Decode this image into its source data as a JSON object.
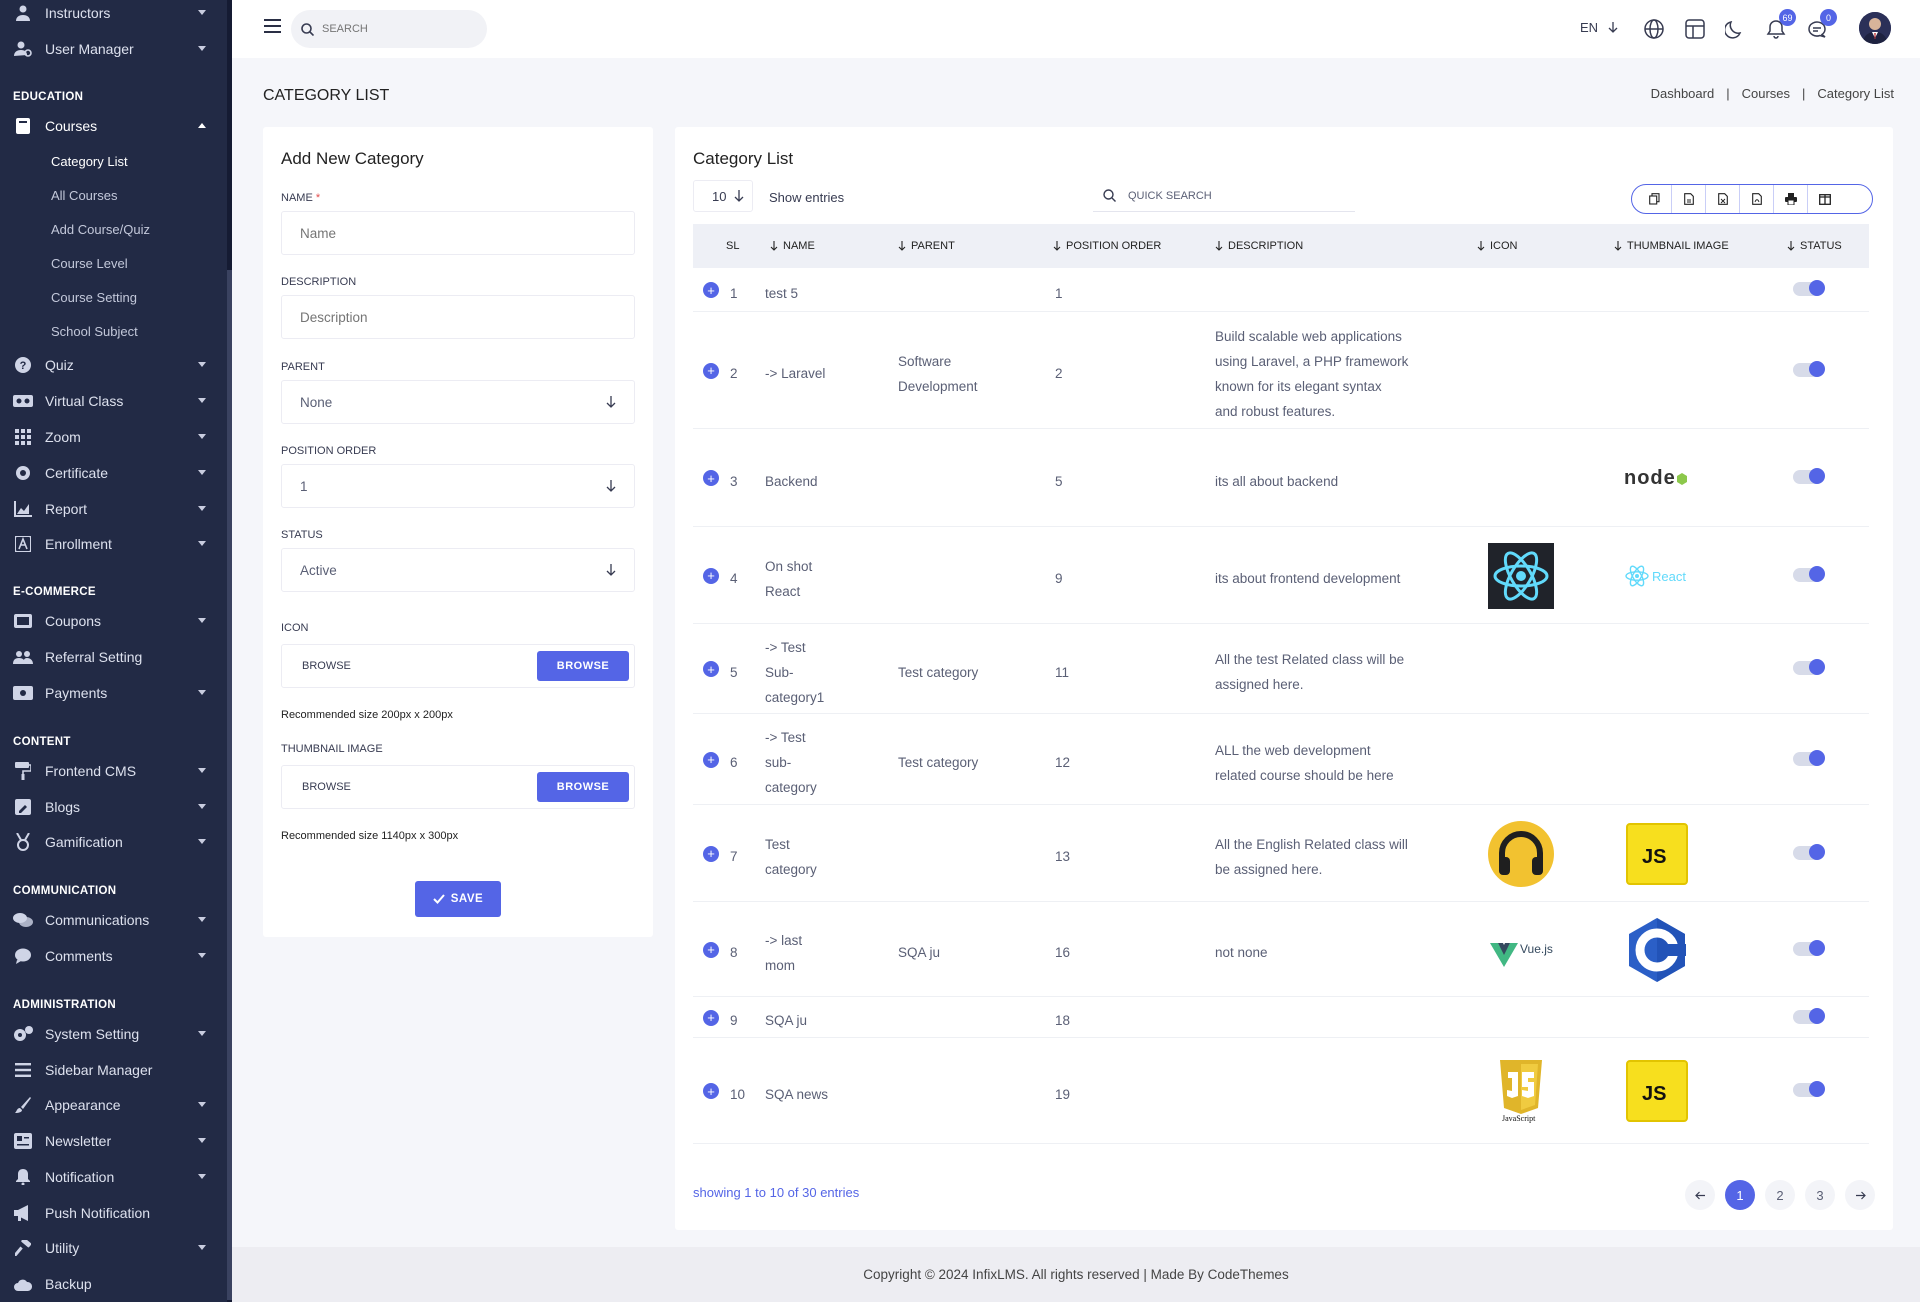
{
  "sidebar": {
    "top_items": [
      {
        "label": "Instructors",
        "icon": "instructor-icon"
      },
      {
        "label": "User Manager",
        "icon": "user-manager-icon"
      }
    ],
    "education_title": "EDUCATION",
    "courses": {
      "label": "Courses",
      "subs": [
        "Category List",
        "All Courses",
        "Add Course/Quiz",
        "Course Level",
        "Course Setting",
        "School Subject"
      ]
    },
    "education_items": [
      {
        "label": "Quiz",
        "icon": "quiz-icon"
      },
      {
        "label": "Virtual Class",
        "icon": "virtual-class-icon"
      },
      {
        "label": "Zoom",
        "icon": "zoom-icon"
      },
      {
        "label": "Certificate",
        "icon": "certificate-icon"
      },
      {
        "label": "Report",
        "icon": "report-icon"
      },
      {
        "label": "Enrollment",
        "icon": "enrollment-icon"
      }
    ],
    "ecommerce_title": "E-COMMERCE",
    "ecommerce_items": [
      {
        "label": "Coupons",
        "icon": "coupon-icon"
      },
      {
        "label": "Referral Setting",
        "icon": "referral-icon"
      },
      {
        "label": "Payments",
        "icon": "payment-icon"
      }
    ],
    "content_title": "CONTENT",
    "content_items": [
      {
        "label": "Frontend CMS",
        "icon": "paint-roller-icon"
      },
      {
        "label": "Blogs",
        "icon": "blog-icon"
      },
      {
        "label": "Gamification",
        "icon": "medal-icon"
      }
    ],
    "communication_title": "COMMUNICATION",
    "communication_items": [
      {
        "label": "Communications",
        "icon": "chat-icon"
      },
      {
        "label": "Comments",
        "icon": "comment-icon"
      }
    ],
    "administration_title": "ADMINISTRATION",
    "administration_items": [
      {
        "label": "System Setting",
        "icon": "gears-icon"
      },
      {
        "label": "Sidebar Manager",
        "icon": "bars-icon"
      },
      {
        "label": "Appearance",
        "icon": "brush-icon"
      },
      {
        "label": "Newsletter",
        "icon": "newsletter-icon"
      },
      {
        "label": "Notification",
        "icon": "bell-icon"
      },
      {
        "label": "Push Notification",
        "icon": "megaphone-icon"
      },
      {
        "label": "Utility",
        "icon": "hammer-icon"
      },
      {
        "label": "Backup",
        "icon": "cloud-icon"
      }
    ]
  },
  "header": {
    "search_placeholder": "SEARCH",
    "language": "EN",
    "notification_count": "69",
    "message_count": "0"
  },
  "page": {
    "title": "CATEGORY LIST",
    "breadcrumb": [
      "Dashboard",
      "Courses",
      "Category List"
    ]
  },
  "form": {
    "title": "Add New Category",
    "name_label": "NAME",
    "required_mark": "*",
    "name_placeholder": "Name",
    "description_label": "DESCRIPTION",
    "description_placeholder": "Description",
    "parent_label": "PARENT",
    "parent_value": "None",
    "position_label": "POSITION ORDER",
    "position_value": "1",
    "status_label": "STATUS",
    "status_value": "Active",
    "icon_label": "ICON",
    "browse_text": "BROWSE",
    "browse_button": "BROWSE",
    "icon_hint": "Recommended size 200px x 200px",
    "thumbnail_label": "THUMBNAIL IMAGE",
    "thumbnail_hint": "Recommended size 1140px x 300px",
    "save_label": "SAVE"
  },
  "table": {
    "title": "Category List",
    "per_page": "10",
    "show_entries": "Show entries",
    "quick_search": "QUICK SEARCH",
    "export_buttons": [
      "copy-icon",
      "csv-icon",
      "excel-icon",
      "pdf-icon",
      "print-icon",
      "columns-icon"
    ],
    "headers": [
      "SL",
      "NAME",
      "PARENT",
      "POSITION ORDER",
      "DESCRIPTION",
      "ICON",
      "THUMBNAIL IMAGE",
      "STATUS"
    ],
    "rows": [
      {
        "sl": "1",
        "name": [
          "test 5"
        ],
        "parent": [],
        "position": "1",
        "description": [],
        "icon": "",
        "thumbnail": "",
        "status": "on"
      },
      {
        "sl": "2",
        "name": [
          "-> Laravel"
        ],
        "parent": [
          "Software",
          "Development"
        ],
        "position": "2",
        "description": [
          "Build scalable web applications",
          "using Laravel, a PHP framework",
          "known for its elegant syntax",
          "and robust features."
        ],
        "icon": "",
        "thumbnail": "",
        "status": "on"
      },
      {
        "sl": "3",
        "name": [
          "Backend"
        ],
        "parent": [],
        "position": "5",
        "description": [
          "its all about backend"
        ],
        "icon": "",
        "thumbnail": "node-logo",
        "thumbnail_text": "node",
        "status": "on"
      },
      {
        "sl": "4",
        "name": [
          "On shot",
          "React"
        ],
        "parent": [],
        "position": "9",
        "description": [
          "its about frontend development"
        ],
        "icon": "react-atom",
        "thumbnail": "react-logo",
        "thumbnail_text": "React",
        "status": "on"
      },
      {
        "sl": "5",
        "name": [
          "-> Test",
          "Sub-",
          "category1"
        ],
        "parent": [
          "Test category"
        ],
        "position": "11",
        "description": [
          "All the test Related class will be",
          "assigned here."
        ],
        "icon": "",
        "thumbnail": "",
        "status": "on"
      },
      {
        "sl": "6",
        "name": [
          "-> Test",
          "sub-",
          "category"
        ],
        "parent": [
          "Test category"
        ],
        "position": "12",
        "description": [
          "ALL the web development",
          "related course should be here"
        ],
        "icon": "",
        "thumbnail": "",
        "status": "on"
      },
      {
        "sl": "7",
        "name": [
          "Test",
          "category"
        ],
        "parent": [],
        "position": "13",
        "description": [
          "All the English Related class will",
          "be assigned here."
        ],
        "icon": "headphones",
        "thumbnail": "js-logo",
        "thumbnail_text": "JS",
        "status": "on"
      },
      {
        "sl": "8",
        "name": [
          "-> last",
          "mom"
        ],
        "parent": [
          "SQA ju"
        ],
        "position": "16",
        "description": [
          "not none"
        ],
        "icon": "vue-logo",
        "icon_text": "Vue.js",
        "thumbnail": "c-logo",
        "status": "on"
      },
      {
        "sl": "9",
        "name": [
          "SQA ju"
        ],
        "parent": [],
        "position": "18",
        "description": [],
        "icon": "",
        "thumbnail": "",
        "status": "on"
      },
      {
        "sl": "10",
        "name": [
          "SQA news"
        ],
        "parent": [],
        "position": "19",
        "description": [],
        "icon": "js-shield",
        "icon_text": "JavaScript",
        "thumbnail": "js-logo",
        "thumbnail_text": "JS",
        "status": "on"
      }
    ],
    "showing": "showing 1 to 10 of 30 entries",
    "pages": [
      "1",
      "2",
      "3"
    ]
  },
  "footer": {
    "text": "Copyright © 2024 InfixLMS. All rights reserved | Made By CodeThemes"
  },
  "colors": {
    "sidebar_bg": "#222a45",
    "accent": "#5465e6",
    "page_bg": "#f5f6fa"
  }
}
